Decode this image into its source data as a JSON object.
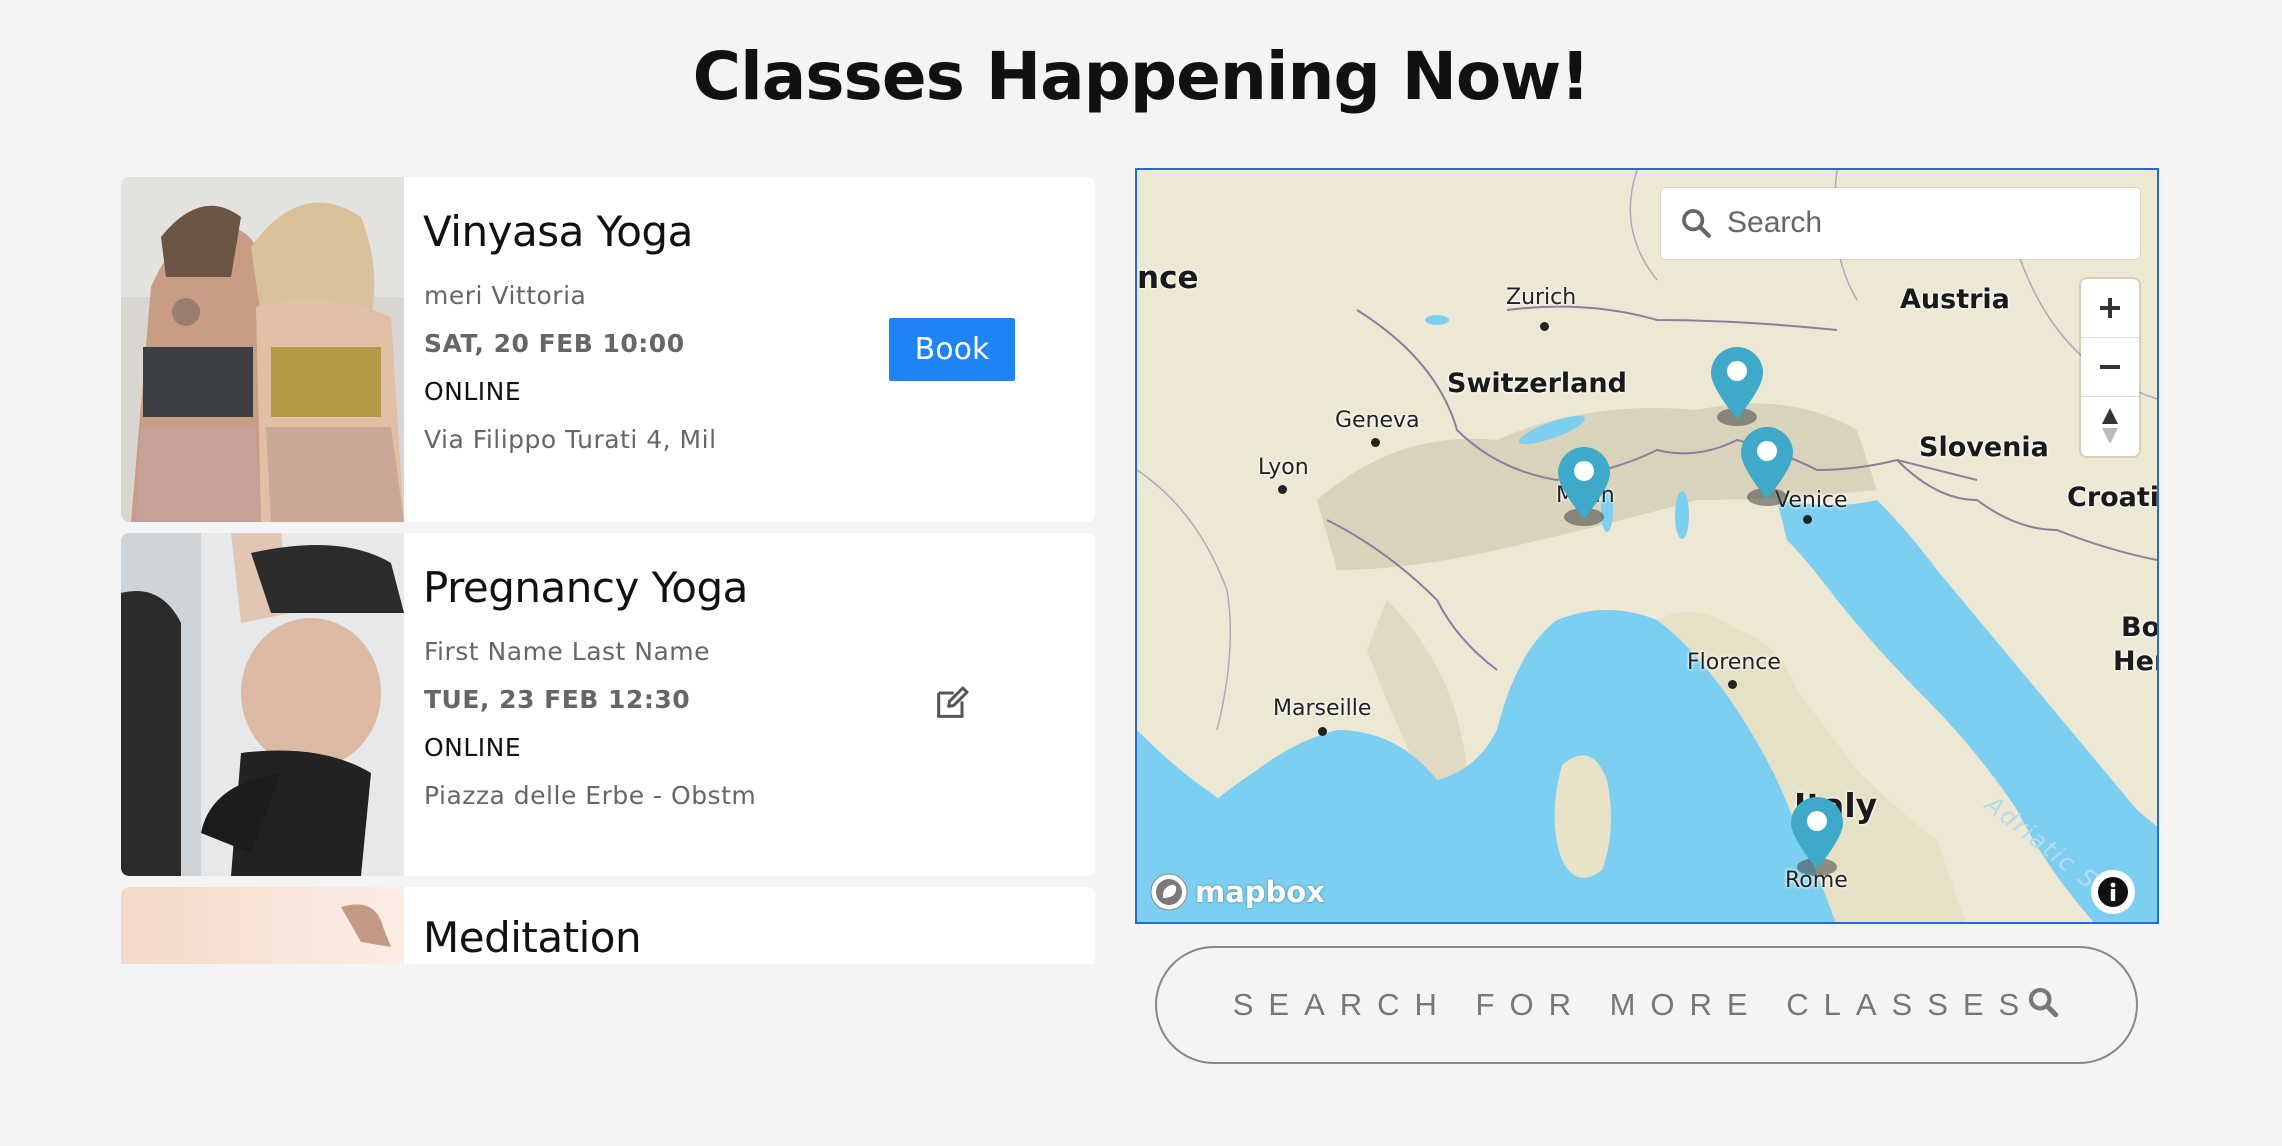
{
  "page": {
    "title": "Classes Happening Now!"
  },
  "classes": [
    {
      "title": "Vinyasa Yoga",
      "teacher": "meri Vittoria",
      "datetime": "SAT, 20 FEB 10:00",
      "mode": "ONLINE",
      "address": "Via Filippo Turati 4, Mil",
      "action_label": "Book"
    },
    {
      "title": "Pregnancy Yoga",
      "teacher": "First Name Last Name",
      "datetime": "TUE, 23 FEB 12:30",
      "mode": "ONLINE",
      "address": "Piazza delle Erbe - Obstm",
      "action_icon": "edit-icon"
    },
    {
      "title": "Meditation"
    }
  ],
  "map": {
    "search_placeholder": "Search",
    "attribution": "mapbox",
    "labels": {
      "france": "nce",
      "zurich": "Zurich",
      "austria": "Austria",
      "switzerland": "Switzerland",
      "geneva": "Geneva",
      "lyon": "Lyon",
      "slovenia": "Slovenia",
      "milan": "Milan",
      "venice": "Venice",
      "croatia": "Croatia",
      "bosnia": "Bos",
      "herz": "Her",
      "florence": "Florence",
      "marseille": "Marseille",
      "italy": "Italy",
      "rome": "Rome",
      "adriatic": "Adriatic Sea"
    },
    "colors": {
      "land": "#ece8d4",
      "water": "#7ccff0",
      "marker": "#3fa9c9"
    },
    "icons": [
      "search-icon",
      "zoom-in-icon",
      "zoom-out-icon",
      "compass-icon",
      "info-icon",
      "map-marker-icon"
    ]
  },
  "more_button": {
    "label": "SEARCH FOR MORE CLASSES"
  }
}
